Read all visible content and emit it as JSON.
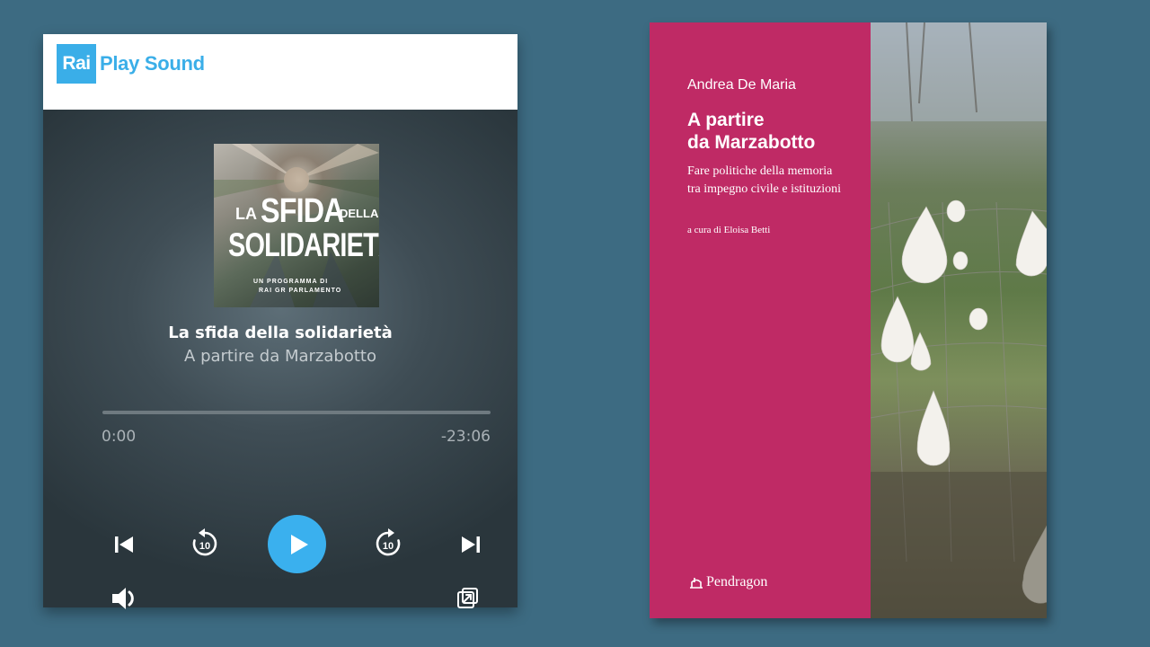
{
  "player": {
    "logo_box": "Rai",
    "logo_text": "Play Sound",
    "cover": {
      "la": "LA",
      "sfida": "SFIDA",
      "della": "DELLA",
      "solidarieta": "SOLIDARIETÀ",
      "program_line1": "UN PROGRAMMA DI",
      "program_line2": "RAI GR PARLAMENTO"
    },
    "title": "La sfida della solidarietà",
    "subtitle": "A partire da Marzabotto",
    "progress_fraction": 0,
    "time_elapsed": "0:00",
    "time_remaining": "-23:06",
    "skip_amount": "10",
    "accent_color": "#3ab0ee"
  },
  "book": {
    "author": "Andrea De Maria",
    "title_line1": "A partire",
    "title_line2": "da Marzabotto",
    "subtitle_line1": "Fare politiche della memoria",
    "subtitle_line2": "tra impegno civile e istituzioni",
    "editor": "a cura di Eloisa Betti",
    "publisher": "Pendragon",
    "cover_color": "#bf2a65"
  }
}
